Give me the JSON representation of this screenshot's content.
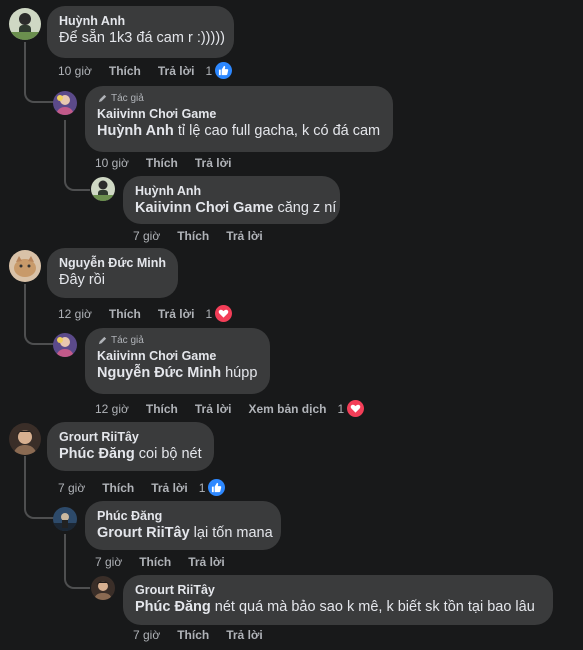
{
  "comments": [
    {
      "name": "Huỳnh Anh",
      "text": "Để sẵn 1k3 đá cam r :)))))",
      "time": "10 giờ",
      "like": "Thích",
      "reply": "Trả lời",
      "reaction_count": "1",
      "reaction": "like"
    },
    {
      "tag": "Tác giả",
      "name": "Kaiivinn Chơi Game",
      "mention": "Huỳnh Anh",
      "text": " tỉ lệ cao full gacha, k có đá cam",
      "time": "10 giờ",
      "like": "Thích",
      "reply": "Trả lời"
    },
    {
      "name": "Huỳnh Anh",
      "mention": "Kaiivinn Chơi Game",
      "text": " căng z ní",
      "time": "7 giờ",
      "like": "Thích",
      "reply": "Trả lời"
    },
    {
      "name": "Nguyễn Đức Minh",
      "text": "Đây rồi",
      "time": "12 giờ",
      "like": "Thích",
      "reply": "Trả lời",
      "reaction_count": "1",
      "reaction": "love"
    },
    {
      "tag": "Tác giả",
      "name": "Kaiivinn Chơi Game",
      "mention": "Nguyễn Đức Minh",
      "text": " húpp",
      "time": "12 giờ",
      "like": "Thích",
      "reply": "Trả lời",
      "translate": "Xem bản dịch",
      "reaction_count": "1",
      "reaction": "love"
    },
    {
      "name": "Grourt RiiTây",
      "mention": "Phúc Đăng",
      "text": " coi bộ nét",
      "time": "7 giờ",
      "like": "Thích",
      "reply": "Trả lời",
      "reaction_count": "1",
      "reaction": "like"
    },
    {
      "name": "Phúc Đăng",
      "mention": "Grourt RiiTây",
      "text": " lại tốn mana",
      "time": "7 giờ",
      "like": "Thích",
      "reply": "Trả lời"
    },
    {
      "name": "Grourt RiiTây",
      "mention": "Phúc Đăng",
      "text": " nét quá mà bảo sao k mê, k biết sk tồn tại bao lâu",
      "time": "7 giờ",
      "like": "Thích",
      "reply": "Trả lời"
    }
  ],
  "colors": {
    "background": "#18191a",
    "bubble": "#3a3b3c",
    "like": "#2d88ff",
    "love": "#f33e58"
  }
}
